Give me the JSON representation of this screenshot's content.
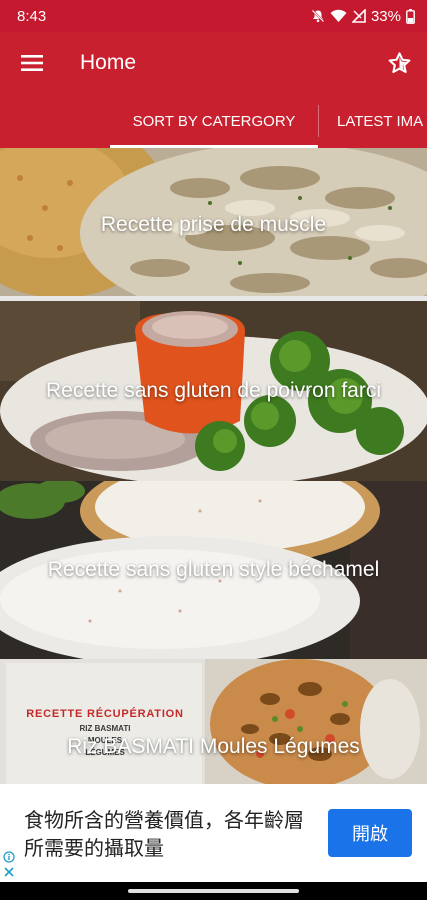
{
  "status_bar": {
    "time": "8:43",
    "battery": "33%",
    "icons": [
      "mute-icon",
      "wifi-icon",
      "signal-icon",
      "battery-icon"
    ]
  },
  "app_bar": {
    "title": "Home",
    "menu_icon": "hamburger-menu-icon",
    "favorite_icon": "star-icon",
    "color": "#c8202f"
  },
  "tabs": [
    {
      "label": "SORT BY CATERGORY",
      "active": true
    },
    {
      "label": "LATEST IMA",
      "active": false
    }
  ],
  "recipes": [
    {
      "label": "Recette prise de muscle"
    },
    {
      "label": "Recette sans gluten de poivron farci"
    },
    {
      "label": "Recette sans gluten style béchamel"
    },
    {
      "label": "Riz BASMATI Moules Légumes",
      "image_text": [
        "RECETTE RÉCUPÉRATION",
        "RIZ BASMATI",
        "MOULES",
        "LÉGUMES"
      ]
    }
  ],
  "ad": {
    "text": "食物所含的營養價值，各年齡層所需要的攝取量",
    "button_label": "開啟",
    "accent": "#1a73e8"
  }
}
